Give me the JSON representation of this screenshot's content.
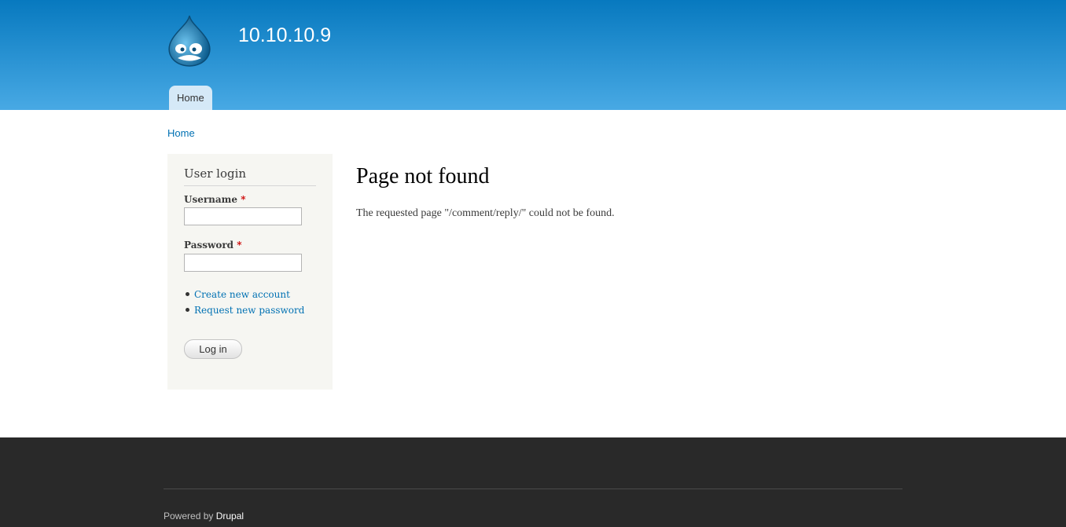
{
  "site": {
    "name": "10.10.10.9",
    "logo_icon": "drupal-drop-icon"
  },
  "nav": {
    "items": [
      {
        "label": "Home"
      }
    ]
  },
  "breadcrumb": {
    "items": [
      {
        "label": "Home"
      }
    ]
  },
  "login_block": {
    "title": "User login",
    "username": {
      "label": "Username",
      "required_marker": "*",
      "value": "",
      "placeholder": ""
    },
    "password": {
      "label": "Password",
      "required_marker": "*",
      "value": "",
      "placeholder": ""
    },
    "links": [
      {
        "label": "Create new account"
      },
      {
        "label": "Request new password"
      }
    ],
    "submit_label": "Log in"
  },
  "content": {
    "title": "Page not found",
    "message": "The requested page \"/comment/reply/\" could not be found."
  },
  "footer": {
    "powered_prefix": "Powered by",
    "powered_link": "Drupal"
  },
  "colors": {
    "header_top": "#0779bf",
    "header_bottom": "#48a9e4",
    "link": "#0071b3",
    "footer_bg": "#292929",
    "sidebar_bg": "#f6f6f2",
    "required": "#cc0000"
  }
}
